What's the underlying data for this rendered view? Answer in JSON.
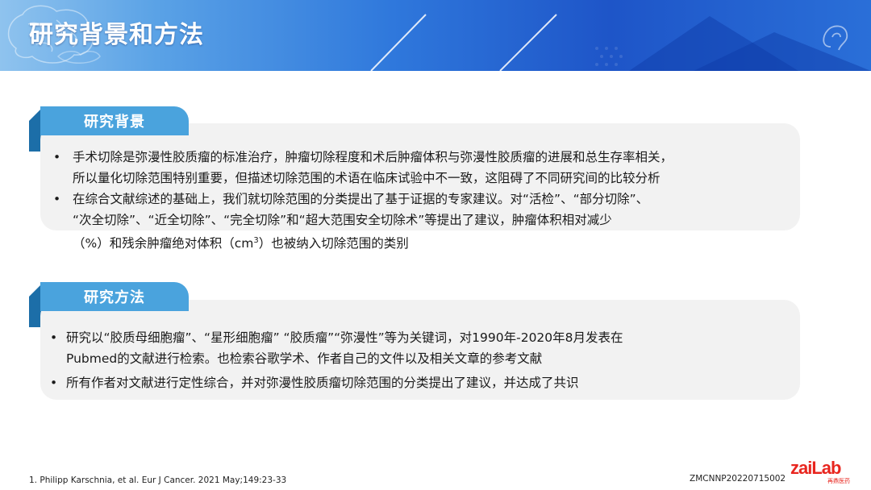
{
  "header": {
    "title": "研究背景和方法"
  },
  "sections": [
    {
      "tab_label": "研究背景",
      "bullets": [
        {
          "marker": "•",
          "lines": [
            "手术切除是弥漫性胶质瘤的标准治疗，肿瘤切除程度和术后肿瘤体积与弥漫性胶质瘤的进展和总生存率相关，",
            "所以量化切除范围特别重要，但描述切除范围的术语在临床试验中不一致，这阻碍了不同研究间的比较分析"
          ]
        },
        {
          "marker": "•",
          "lines": [
            "在综合文献综述的基础上，我们就切除范围的分类提出了基于证据的专家建议。对“活检”、“部分切除”、",
            "“次全切除”、“近全切除”、“完全切除”和“超大范围安全切除术”等提出了建议，肿瘤体积相对减少",
            "（%）和残余肿瘤绝对体积（cm",
            "3",
            "）也被纳入切除范围的类别"
          ]
        }
      ]
    },
    {
      "tab_label": "研究方法",
      "bullets": [
        {
          "marker": "•",
          "lines": [
            "研究以“胶质母细胞瘤”、“星形细胞瘤” “胶质瘤”“弥漫性”等为关键词，对1990年-2020年8月发表在",
            "Pubmed的文献进行检索。也检索谷歌学术、作者自己的文件以及相关文章的参考文献"
          ]
        },
        {
          "marker": "•",
          "lines": [
            "所有作者对文献进行定性综合，并对弥漫性胶质瘤切除范围的分类提出了建议，并达成了共识"
          ]
        }
      ]
    }
  ],
  "footer": {
    "reference": "1. Philipp Karschnia, et al. Eur J Cancer. 2021 May;149:23-33",
    "doc_code": "ZMCNNP20220715002",
    "logo_text": "zaiLab",
    "logo_subtext": "再鼎医药"
  },
  "colors": {
    "tab": "#4aa3dd",
    "tab_fold": "#1c6ea8",
    "box": "#f2f2f2",
    "logo": "#e8261f"
  }
}
